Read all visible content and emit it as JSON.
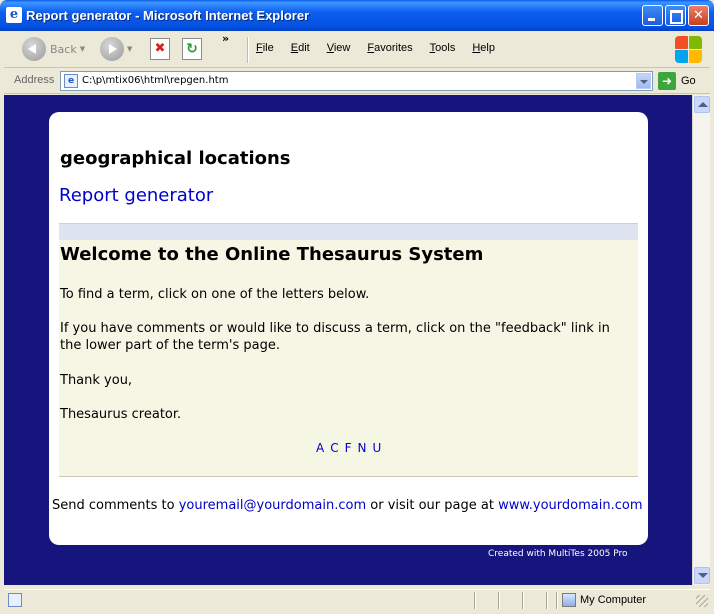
{
  "window": {
    "title": "Report generator - Microsoft Internet Explorer",
    "app_icon": "ie-icon"
  },
  "toolbar": {
    "back_label": "Back",
    "more_glyph": "»",
    "menu": [
      "File",
      "Edit",
      "View",
      "Favorites",
      "Tools",
      "Help"
    ]
  },
  "address": {
    "label": "Address",
    "url": "C:\\p\\mtix06\\html\\repgen.htm",
    "go_label": "Go"
  },
  "page": {
    "heading": "geographical locations",
    "report_link": "Report generator",
    "welcome": "Welcome to the Online Thesaurus System",
    "paragraphs": [
      "To find a term, click on one of the letters below.",
      "If you have comments or would like to discuss a term, click on the \"feedback\" link in the lower part of the term's page.",
      "Thank you,",
      "Thesaurus creator."
    ],
    "letters": [
      "A",
      "C",
      "F",
      "N",
      "U"
    ],
    "footer": {
      "prefix": "Send comments to ",
      "email": "youremail@yourdomain.com",
      "middle": " or visit our page at ",
      "site": "www.yourdomain.com"
    },
    "credit": "Created with MultiTes 2005 Pro"
  },
  "status": {
    "zone": "My Computer"
  },
  "colors": {
    "page_background": "#15157d",
    "link": "#0000cc",
    "panel": "#f6f6e4",
    "band": "#dde3ef"
  }
}
